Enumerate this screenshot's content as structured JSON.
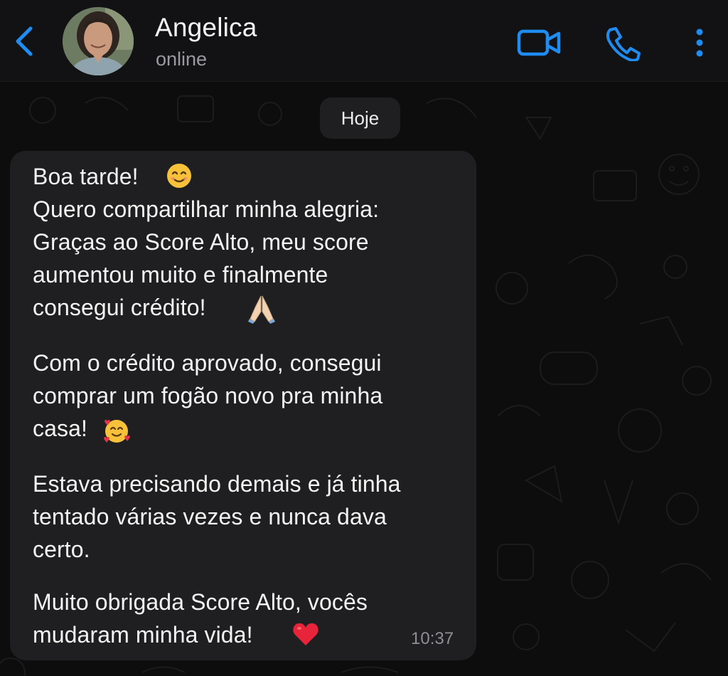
{
  "header": {
    "contact_name": "Angelica",
    "status": "online",
    "back_icon": "chevron-left-icon",
    "video_icon": "video-camera-icon",
    "call_icon": "phone-icon",
    "more_icon": "vertical-ellipsis-icon"
  },
  "chat": {
    "date_divider": "Hoje",
    "message": {
      "lines": [
        "Boa tarde!",
        "Quero compartilhar minha alegria:",
        "Graças ao Score Alto, meu score",
        "aumentou muito e finalmente",
        "consegui crédito!",
        "Com o crédito aprovado, consegui",
        "comprar um fogão novo pra minha",
        "casa!",
        "Estava precisando demais e já tinha",
        "tentado várias vezes e nunca dava",
        "certo.",
        "Muito obrigada Score Alto, vocês",
        "mudaram minha vida!"
      ],
      "emojis": [
        "smiling-face-icon",
        "folded-hands-icon",
        "smiling-face-with-hearts-icon",
        "red-heart-icon"
      ],
      "time": "10:37"
    }
  },
  "colors": {
    "accent": "#1e8cf0",
    "bubble": "#1f1f21",
    "background": "#0d0d0e",
    "header": "#121214"
  }
}
